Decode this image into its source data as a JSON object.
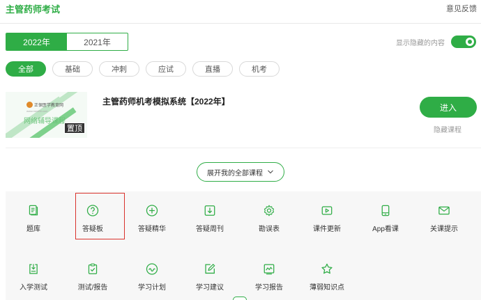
{
  "header": {
    "title": "主管药师考试",
    "feedback": "意见反馈"
  },
  "years": [
    {
      "label": "2022年",
      "active": true
    },
    {
      "label": "2021年",
      "active": false
    }
  ],
  "toggle": {
    "label": "显示隐藏的内容",
    "on": true
  },
  "filters": [
    {
      "label": "全部",
      "active": true
    },
    {
      "label": "基础",
      "active": false
    },
    {
      "label": "冲刺",
      "active": false
    },
    {
      "label": "应试",
      "active": false
    },
    {
      "label": "直播",
      "active": false
    },
    {
      "label": "机考",
      "active": false
    }
  ],
  "course": {
    "thumb_logo": "正保医学教育网",
    "thumb_url": "www.med66.com",
    "thumb_text": "网络辅导课程",
    "badge": "置顶",
    "title": "主管药师机考模拟系统【2022年】",
    "enter": "进入",
    "hide": "隐藏课程"
  },
  "expand_label": "展开我的全部课程",
  "tools": [
    {
      "label": "题库",
      "icon": "question-bank-icon"
    },
    {
      "label": "答疑板",
      "icon": "question-circle-icon"
    },
    {
      "label": "答疑精华",
      "icon": "plus-circle-icon"
    },
    {
      "label": "答疑周刊",
      "icon": "download-box-icon"
    },
    {
      "label": "勘误表",
      "icon": "gear-icon"
    },
    {
      "label": "课件更新",
      "icon": "play-box-icon"
    },
    {
      "label": "App看课",
      "icon": "phone-icon"
    },
    {
      "label": "关课提示",
      "icon": "mail-icon"
    },
    {
      "label": "入学测试",
      "icon": "entry-test-icon"
    },
    {
      "label": "测试/报告",
      "icon": "clipboard-check-icon"
    },
    {
      "label": "学习计划",
      "icon": "wave-circle-icon"
    },
    {
      "label": "学习建议",
      "icon": "edit-icon"
    },
    {
      "label": "学习报告",
      "icon": "report-chart-icon"
    },
    {
      "label": "薄弱知识点",
      "icon": "star-icon"
    }
  ]
}
